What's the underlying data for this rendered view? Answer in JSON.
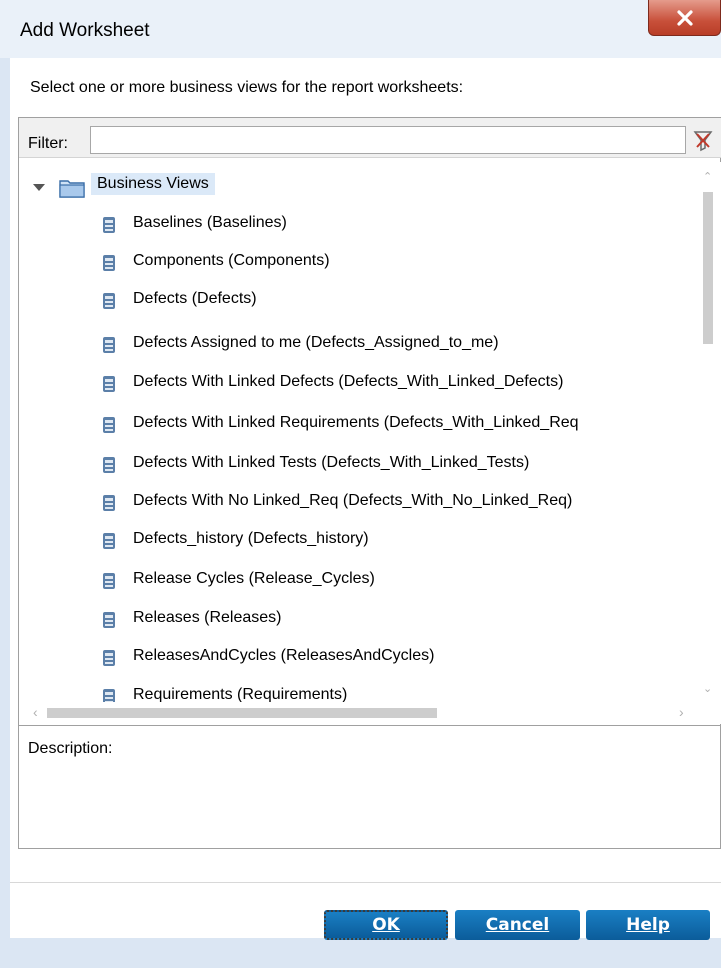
{
  "window": {
    "title": "Add Worksheet",
    "close_label": "X"
  },
  "instruction": "Select one or more business views for the report worksheets:",
  "filter": {
    "label": "Filter:",
    "value": ""
  },
  "tree": {
    "root_label": "Business Views",
    "items": [
      "Baselines (Baselines)",
      "Components (Components)",
      "Defects (Defects)",
      "Defects Assigned to me (Defects_Assigned_to_me)",
      "Defects With Linked Defects (Defects_With_Linked_Defects)",
      "Defects With Linked Requirements (Defects_With_Linked_Req",
      "Defects With Linked Tests (Defects_With_Linked_Tests)",
      "Defects With No Linked_Req (Defects_With_No_Linked_Req)",
      "Defects_history (Defects_history)",
      "Release Cycles (Release_Cycles)",
      "Releases (Releases)",
      "ReleasesAndCycles (ReleasesAndCycles)",
      "Requirements (Requirements)"
    ]
  },
  "description": {
    "label": "Description:",
    "text": ""
  },
  "buttons": {
    "ok": "OK",
    "cancel": "Cancel",
    "help": "Help"
  },
  "colors": {
    "button_blue": "#0e6aae",
    "close_red": "#c8503a",
    "selection": "#dbe9f8"
  },
  "icons": {
    "folder": "folder-icon",
    "view": "business-view-icon",
    "filter_clear": "clear-filter-icon"
  }
}
